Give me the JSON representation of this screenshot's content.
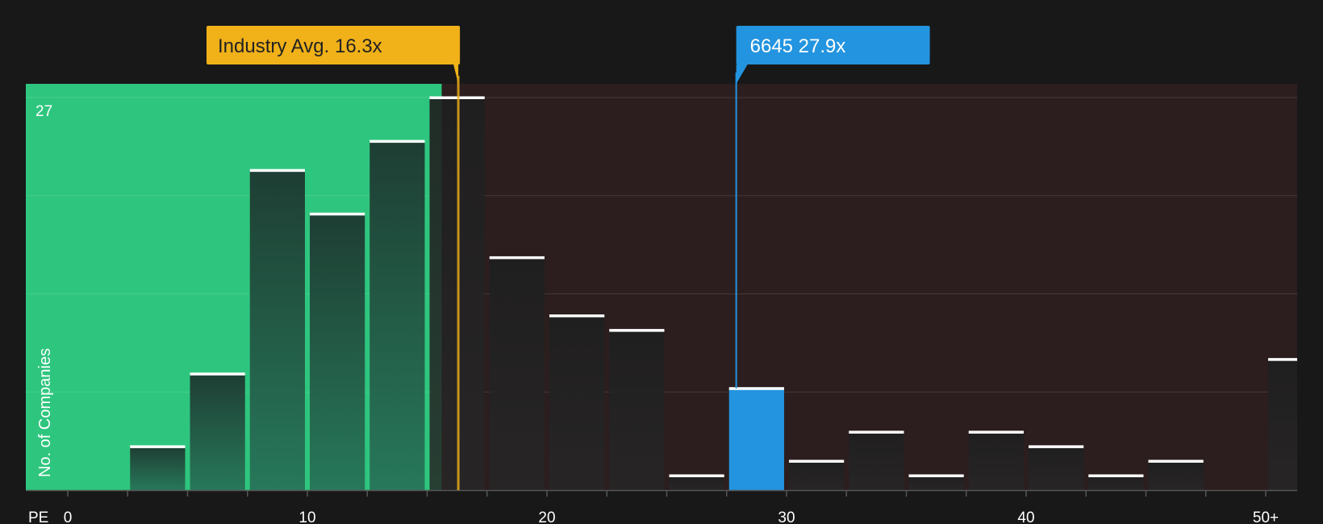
{
  "chart_data": {
    "type": "bar",
    "xlabel": "PE",
    "ylabel": "No. of Companies",
    "x_ticks": [
      {
        "value": 0,
        "label": "0"
      },
      {
        "value": 10,
        "label": "10"
      },
      {
        "value": 20,
        "label": "20"
      },
      {
        "value": 30,
        "label": "30"
      },
      {
        "value": 40,
        "label": "40"
      },
      {
        "value": 50,
        "label": "50+"
      }
    ],
    "ylim": [
      0,
      27
    ],
    "y_max_label": "27",
    "grid": true,
    "bin_width": 2.5,
    "bins": [
      {
        "start": 0,
        "value": 0
      },
      {
        "start": 2.5,
        "value": 3
      },
      {
        "start": 5,
        "value": 8
      },
      {
        "start": 7.5,
        "value": 22
      },
      {
        "start": 10,
        "value": 19
      },
      {
        "start": 12.5,
        "value": 24
      },
      {
        "start": 15,
        "value": 27
      },
      {
        "start": 17.5,
        "value": 16
      },
      {
        "start": 20,
        "value": 12
      },
      {
        "start": 22.5,
        "value": 11
      },
      {
        "start": 25,
        "value": 1
      },
      {
        "start": 27.5,
        "value": 7,
        "highlight": true
      },
      {
        "start": 30,
        "value": 2
      },
      {
        "start": 32.5,
        "value": 4
      },
      {
        "start": 35,
        "value": 1
      },
      {
        "start": 37.5,
        "value": 4
      },
      {
        "start": 40,
        "value": 3
      },
      {
        "start": 42.5,
        "value": 1
      },
      {
        "start": 45,
        "value": 2
      },
      {
        "start": 47.5,
        "value": 0
      },
      {
        "start": 50,
        "value": 9
      }
    ],
    "industry_avg": {
      "value": 16.3,
      "label": "Industry Avg. 16.3x",
      "color": "#f0b119"
    },
    "company": {
      "value": 27.9,
      "label": "6645 27.9x",
      "color": "#2394df"
    },
    "colors": {
      "background": "#181818",
      "below_zone": "#2ec67e",
      "above_zone": "#2c1e1e",
      "highlight_bar": "#2394df",
      "bar_cap": "#ffffff",
      "axis": "#555555",
      "text": "#ffffff"
    }
  }
}
